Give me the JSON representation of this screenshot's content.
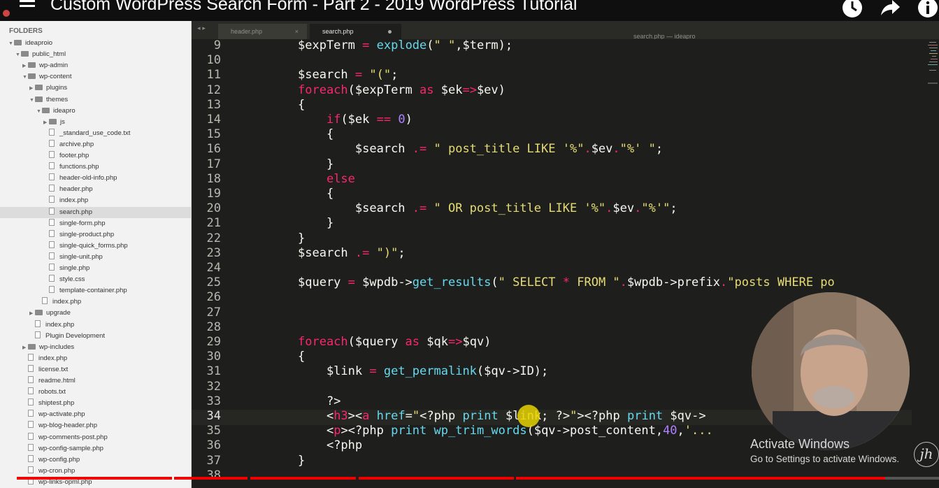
{
  "video": {
    "title": "Custom WordPress Search Form - Part 2 - 2019 WordPress Tutorial",
    "progress": 0.94
  },
  "sidebar": {
    "header": "FOLDERS",
    "items": [
      {
        "label": "ideaproio",
        "type": "folder",
        "depth": 0,
        "open": true
      },
      {
        "label": "public_html",
        "type": "folder",
        "depth": 1,
        "open": true
      },
      {
        "label": "wp-admin",
        "type": "folder",
        "depth": 2,
        "open": false
      },
      {
        "label": "wp-content",
        "type": "folder",
        "depth": 2,
        "open": true
      },
      {
        "label": "plugins",
        "type": "folder",
        "depth": 3,
        "open": false
      },
      {
        "label": "themes",
        "type": "folder",
        "depth": 3,
        "open": true
      },
      {
        "label": "ideapro",
        "type": "folder",
        "depth": 4,
        "open": true
      },
      {
        "label": "js",
        "type": "folder",
        "depth": 5,
        "open": false
      },
      {
        "label": "_standard_use_code.txt",
        "type": "file",
        "depth": 5
      },
      {
        "label": "archive.php",
        "type": "file",
        "depth": 5
      },
      {
        "label": "footer.php",
        "type": "file",
        "depth": 5
      },
      {
        "label": "functions.php",
        "type": "file",
        "depth": 5
      },
      {
        "label": "header-old-info.php",
        "type": "file",
        "depth": 5
      },
      {
        "label": "header.php",
        "type": "file",
        "depth": 5
      },
      {
        "label": "index.php",
        "type": "file",
        "depth": 5
      },
      {
        "label": "search.php",
        "type": "file",
        "depth": 5,
        "selected": true
      },
      {
        "label": "single-form.php",
        "type": "file",
        "depth": 5
      },
      {
        "label": "single-product.php",
        "type": "file",
        "depth": 5
      },
      {
        "label": "single-quick_forms.php",
        "type": "file",
        "depth": 5
      },
      {
        "label": "single-unit.php",
        "type": "file",
        "depth": 5
      },
      {
        "label": "single.php",
        "type": "file",
        "depth": 5
      },
      {
        "label": "style.css",
        "type": "file",
        "depth": 5
      },
      {
        "label": "template-container.php",
        "type": "file",
        "depth": 5
      },
      {
        "label": "index.php",
        "type": "file",
        "depth": 4
      },
      {
        "label": "upgrade",
        "type": "folder",
        "depth": 3,
        "open": false
      },
      {
        "label": "index.php",
        "type": "file",
        "depth": 3
      },
      {
        "label": "Plugin Development",
        "type": "file",
        "depth": 3
      },
      {
        "label": "wp-includes",
        "type": "folder",
        "depth": 2,
        "open": false
      },
      {
        "label": "index.php",
        "type": "file",
        "depth": 2
      },
      {
        "label": "license.txt",
        "type": "file",
        "depth": 2
      },
      {
        "label": "readme.html",
        "type": "file",
        "depth": 2
      },
      {
        "label": "robots.txt",
        "type": "file",
        "depth": 2
      },
      {
        "label": "shiptest.php",
        "type": "file",
        "depth": 2
      },
      {
        "label": "wp-activate.php",
        "type": "file",
        "depth": 2
      },
      {
        "label": "wp-blog-header.php",
        "type": "file",
        "depth": 2
      },
      {
        "label": "wp-comments-post.php",
        "type": "file",
        "depth": 2
      },
      {
        "label": "wp-config-sample.php",
        "type": "file",
        "depth": 2
      },
      {
        "label": "wp-config.php",
        "type": "file",
        "depth": 2
      },
      {
        "label": "wp-cron.php",
        "type": "file",
        "depth": 2
      },
      {
        "label": "wp-links-opml.php",
        "type": "file",
        "depth": 2
      }
    ]
  },
  "tabs": [
    {
      "label": "header.php",
      "active": false,
      "close": "×"
    },
    {
      "label": "search.php",
      "active": true
    }
  ],
  "tab_nav": "◂ ▸",
  "editor_subtitle": "search.php — ideapro",
  "editor": {
    "current_line": 34,
    "lines": [
      {
        "n": "9",
        "code": [
          [
            "v",
            "$expTerm "
          ],
          [
            "o",
            "="
          ],
          [
            "v",
            " "
          ],
          [
            "f",
            "explode"
          ],
          [
            "v",
            "("
          ],
          [
            "s",
            "\" \""
          ],
          [
            "v",
            ",$term);"
          ]
        ]
      },
      {
        "n": "10",
        "code": []
      },
      {
        "n": "11",
        "code": [
          [
            "v",
            "$search "
          ],
          [
            "o",
            "="
          ],
          [
            "v",
            " "
          ],
          [
            "s",
            "\"(\""
          ],
          [
            "v",
            ";"
          ]
        ]
      },
      {
        "n": "12",
        "code": [
          [
            "k",
            "foreach"
          ],
          [
            "v",
            "($expTerm "
          ],
          [
            "k",
            "as"
          ],
          [
            "v",
            " $ek"
          ],
          [
            "o",
            "=>"
          ],
          [
            "v",
            "$ev)"
          ]
        ]
      },
      {
        "n": "13",
        "code": [
          [
            "v",
            "{"
          ]
        ]
      },
      {
        "n": "14",
        "code": [
          [
            "v",
            "    "
          ],
          [
            "k",
            "if"
          ],
          [
            "v",
            "($ek "
          ],
          [
            "o",
            "=="
          ],
          [
            "v",
            " "
          ],
          [
            "n",
            "0"
          ],
          [
            "v",
            ")"
          ]
        ]
      },
      {
        "n": "15",
        "code": [
          [
            "v",
            "    {"
          ]
        ]
      },
      {
        "n": "16",
        "code": [
          [
            "v",
            "        $search "
          ],
          [
            "o",
            ".="
          ],
          [
            "v",
            " "
          ],
          [
            "s",
            "\" post_title LIKE '%\""
          ],
          [
            "o",
            "."
          ],
          [
            "v",
            "$ev"
          ],
          [
            "o",
            "."
          ],
          [
            "s",
            "\"%' \""
          ],
          [
            "v",
            ";"
          ]
        ]
      },
      {
        "n": "17",
        "code": [
          [
            "v",
            "    }"
          ]
        ]
      },
      {
        "n": "18",
        "code": [
          [
            "v",
            "    "
          ],
          [
            "k",
            "else"
          ]
        ]
      },
      {
        "n": "19",
        "code": [
          [
            "v",
            "    {"
          ]
        ]
      },
      {
        "n": "20",
        "code": [
          [
            "v",
            "        $search "
          ],
          [
            "o",
            ".="
          ],
          [
            "v",
            " "
          ],
          [
            "s",
            "\" OR post_title LIKE '%\""
          ],
          [
            "o",
            "."
          ],
          [
            "v",
            "$ev"
          ],
          [
            "o",
            "."
          ],
          [
            "s",
            "\"%'\""
          ],
          [
            "v",
            ";"
          ]
        ]
      },
      {
        "n": "21",
        "code": [
          [
            "v",
            "    }"
          ]
        ]
      },
      {
        "n": "22",
        "code": [
          [
            "v",
            "}"
          ]
        ]
      },
      {
        "n": "23",
        "code": [
          [
            "v",
            "$search "
          ],
          [
            "o",
            ".="
          ],
          [
            "v",
            " "
          ],
          [
            "s",
            "\")\""
          ],
          [
            "v",
            ";"
          ]
        ]
      },
      {
        "n": "24",
        "code": []
      },
      {
        "n": "25",
        "code": [
          [
            "v",
            "$query "
          ],
          [
            "o",
            "="
          ],
          [
            "v",
            " $wpdb->"
          ],
          [
            "f",
            "get_results"
          ],
          [
            "v",
            "("
          ],
          [
            "s",
            "\" SELECT "
          ],
          [
            "o",
            "*"
          ],
          [
            "s",
            " FROM \""
          ],
          [
            "o",
            "."
          ],
          [
            "v",
            "$wpdb->prefix"
          ],
          [
            "o",
            "."
          ],
          [
            "s",
            "\"posts WHERE po"
          ]
        ]
      },
      {
        "n": "26",
        "code": []
      },
      {
        "n": "27",
        "code": []
      },
      {
        "n": "28",
        "code": []
      },
      {
        "n": "29",
        "code": [
          [
            "k",
            "foreach"
          ],
          [
            "v",
            "($query "
          ],
          [
            "k",
            "as"
          ],
          [
            "v",
            " $qk"
          ],
          [
            "o",
            "=>"
          ],
          [
            "v",
            "$qv)"
          ]
        ]
      },
      {
        "n": "30",
        "code": [
          [
            "v",
            "{"
          ]
        ]
      },
      {
        "n": "31",
        "code": [
          [
            "v",
            "    $link "
          ],
          [
            "o",
            "="
          ],
          [
            "v",
            " "
          ],
          [
            "f",
            "get_permalink"
          ],
          [
            "v",
            "($qv->ID);"
          ]
        ]
      },
      {
        "n": "32",
        "code": []
      },
      {
        "n": "33",
        "code": [
          [
            "v",
            "    ?>"
          ]
        ]
      },
      {
        "n": "34",
        "code": [
          [
            "v",
            "    <"
          ],
          [
            "k",
            "h3"
          ],
          [
            "v",
            "><"
          ],
          [
            "k",
            "a"
          ],
          [
            "v",
            " "
          ],
          [
            "f",
            "href"
          ],
          [
            "v",
            "="
          ],
          [
            "s",
            "\""
          ],
          [
            "v",
            "<?php "
          ],
          [
            "f",
            "print"
          ],
          [
            "v",
            " $link; ?>"
          ],
          [
            "s",
            "\""
          ],
          [
            "v",
            "><?php "
          ],
          [
            "f",
            "print"
          ],
          [
            "v",
            " $qv->"
          ]
        ]
      },
      {
        "n": "35",
        "code": [
          [
            "v",
            "    <"
          ],
          [
            "k",
            "p"
          ],
          [
            "v",
            "><?php "
          ],
          [
            "f",
            "print"
          ],
          [
            "v",
            " "
          ],
          [
            "f",
            "wp_trim_words"
          ],
          [
            "v",
            "($qv->post_content,"
          ],
          [
            "n",
            "40"
          ],
          [
            "v",
            ","
          ],
          [
            "s",
            "'..."
          ]
        ]
      },
      {
        "n": "36",
        "code": [
          [
            "v",
            "    <?php"
          ]
        ]
      },
      {
        "n": "37",
        "code": [
          [
            "v",
            "}"
          ]
        ]
      },
      {
        "n": "38",
        "code": []
      }
    ]
  },
  "overlay": {
    "activate_title": "Activate Windows",
    "activate_sub": "Go to Settings to activate Windows.",
    "logo": "jh"
  },
  "colors": {
    "keyword": "#f92672",
    "function": "#66d9ef",
    "string": "#e6db74",
    "number": "#ae81ff",
    "text": "#f8f8f2",
    "progress": "#ee0000"
  },
  "icons": [
    "menu-icon",
    "clock-icon",
    "share-icon",
    "info-icon",
    "folder-icon",
    "file-icon",
    "close-icon",
    "webcam-presenter"
  ]
}
